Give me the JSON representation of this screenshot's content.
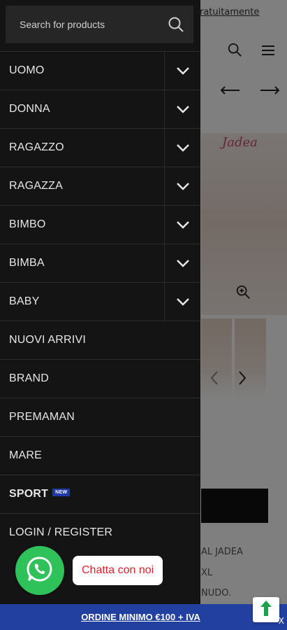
{
  "search": {
    "placeholder": "Search for products"
  },
  "menu": [
    {
      "label": "UOMO",
      "expandable": true
    },
    {
      "label": "DONNA",
      "expandable": true
    },
    {
      "label": "RAGAZZO",
      "expandable": true
    },
    {
      "label": "RAGAZZA",
      "expandable": true
    },
    {
      "label": "BIMBO",
      "expandable": true
    },
    {
      "label": "BIMBA",
      "expandable": true
    },
    {
      "label": "BABY",
      "expandable": true
    },
    {
      "label": "NUOVI ARRIVI",
      "expandable": false
    },
    {
      "label": "BRAND",
      "expandable": false
    },
    {
      "label": "PREMAMAN",
      "expandable": false
    },
    {
      "label": "MARE",
      "expandable": false
    },
    {
      "label": "SPORT",
      "expandable": false,
      "badge": "NEW"
    },
    {
      "label": "LOGIN / REGISTER",
      "expandable": false
    }
  ],
  "background_page": {
    "topbar_text": "ratuitamente",
    "brand_logo": "Jadea",
    "desc_lines": [
      "AL JADEA",
      "XL",
      "NUDO."
    ]
  },
  "whatsapp": {
    "bubble_text": "Chatta con noi",
    "icon": "whatsapp-icon"
  },
  "banner": {
    "text": "ORDINE MINIMO €100 + IVA",
    "close": "X"
  },
  "colors": {
    "drawer_bg": "#141414",
    "search_bg": "#262626",
    "badge": "#1f3aa8",
    "whatsapp": "#2fc15a",
    "chat_text": "#e0202a",
    "banner_bg": "#2140a0"
  }
}
